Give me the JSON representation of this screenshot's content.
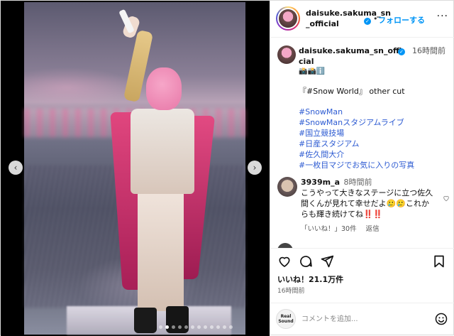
{
  "header": {
    "username": "daisuke.sakuma_sn_official",
    "separator": "•",
    "follow_label": "フォローする",
    "more_label": "···"
  },
  "caption": {
    "username": "daisuke.sakuma_sn_official",
    "time": "16時間前",
    "emojis": "📸📸ℹ️",
    "text": "『#Snow World』 other cut",
    "hashtags": [
      "#SnowMan",
      "#SnowManスタジアムライブ",
      "#国立競技場",
      "#日産スタジアム",
      "#佐久間大介",
      "#一枚目マジでお気に入りの写真"
    ]
  },
  "comment": {
    "username": "3939m_a",
    "time": "8時間前",
    "text": "こうやって大きなステージに立つ佐久間くんが見れて幸せだよ🥲🥲これからも輝き続けてね‼️‼️",
    "likes_label": "「いいね！」30件",
    "reply_label": "返信"
  },
  "actions": {
    "likes": "いいね！21.1万件",
    "date": "16時間前"
  },
  "compose": {
    "badge_line1": "Real",
    "badge_line2": "Sound",
    "placeholder": "コメントを追加..."
  },
  "media": {
    "prev_label": "‹",
    "next_label": "›",
    "slide_count": 12,
    "active_slide": 1
  },
  "colors": {
    "accent": "#0095f6",
    "hashtag": "#2d5bd2",
    "like_red": "#ed4956"
  }
}
